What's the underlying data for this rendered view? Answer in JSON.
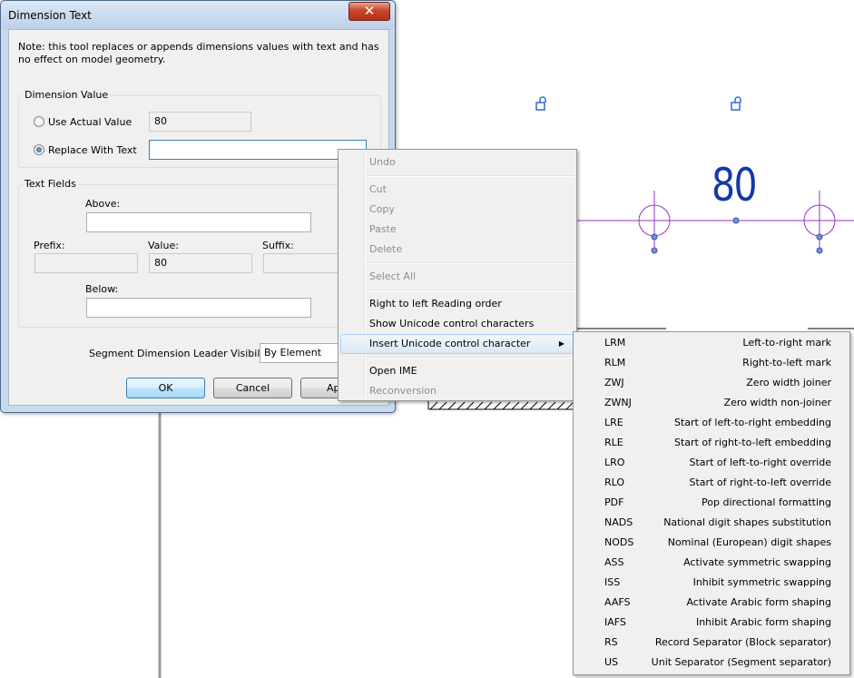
{
  "dialog": {
    "title": "Dimension Text",
    "close_glyph": "✕",
    "note": "Note: this tool replaces or appends dimensions values with text and has no effect on model geometry.",
    "dimension_value": {
      "group_label": "Dimension Value",
      "use_actual_label": "Use Actual Value",
      "actual_value": "80",
      "replace_label": "Replace With Text",
      "replace_value": "",
      "selected": "Replace With Text"
    },
    "text_fields": {
      "group_label": "Text Fields",
      "above_label": "Above:",
      "above_value": "",
      "prefix_label": "Prefix:",
      "prefix_value": "",
      "value_label": "Value:",
      "value_value": "80",
      "suffix_label": "Suffix:",
      "suffix_value": "",
      "below_label": "Below:",
      "below_value": ""
    },
    "leader_visibility_label": "Segment Dimension Leader Visibility:",
    "leader_visibility_value": "By Element",
    "ok_label": "OK",
    "cancel_label": "Cancel",
    "apply_label": "Ap"
  },
  "canvas": {
    "dimension_text": "80",
    "dimension_color": "#1439a8",
    "line_color": "#9b30c8",
    "icon_color": "#2e6bd6"
  },
  "context_menu": {
    "items": [
      {
        "label": "Undo",
        "enabled": false
      },
      {
        "label": "Cut",
        "enabled": false
      },
      {
        "label": "Copy",
        "enabled": false
      },
      {
        "label": "Paste",
        "enabled": false
      },
      {
        "label": "Delete",
        "enabled": false
      },
      {
        "label": "Select All",
        "enabled": false
      },
      {
        "label": "Right to left Reading order",
        "enabled": true
      },
      {
        "label": "Show Unicode control characters",
        "enabled": true
      },
      {
        "label": "Insert Unicode control character",
        "enabled": true,
        "highlighted": true,
        "submenu_arrow": "▶"
      },
      {
        "label": "Open IME",
        "enabled": true
      },
      {
        "label": "Reconversion",
        "enabled": false
      }
    ]
  },
  "submenu": {
    "items": [
      {
        "code": "LRM",
        "desc": "Left-to-right mark"
      },
      {
        "code": "RLM",
        "desc": "Right-to-left mark"
      },
      {
        "code": "ZWJ",
        "desc": "Zero width joiner"
      },
      {
        "code": "ZWNJ",
        "desc": "Zero width non-joiner"
      },
      {
        "code": "LRE",
        "desc": "Start of left-to-right embedding"
      },
      {
        "code": "RLE",
        "desc": "Start of right-to-left embedding"
      },
      {
        "code": "LRO",
        "desc": "Start of left-to-right override"
      },
      {
        "code": "RLO",
        "desc": "Start of right-to-left override"
      },
      {
        "code": "PDF",
        "desc": "Pop directional formatting"
      },
      {
        "code": "NADS",
        "desc": "National digit shapes substitution"
      },
      {
        "code": "NODS",
        "desc": "Nominal (European) digit shapes"
      },
      {
        "code": "ASS",
        "desc": "Activate symmetric swapping"
      },
      {
        "code": "ISS",
        "desc": "Inhibit symmetric swapping"
      },
      {
        "code": "AAFS",
        "desc": "Activate Arabic form shaping"
      },
      {
        "code": "IAFS",
        "desc": "Inhibit Arabic form shaping"
      },
      {
        "code": "RS",
        "desc": "Record Separator (Block separator)"
      },
      {
        "code": "US",
        "desc": "Unit Separator (Segment separator)"
      }
    ]
  }
}
